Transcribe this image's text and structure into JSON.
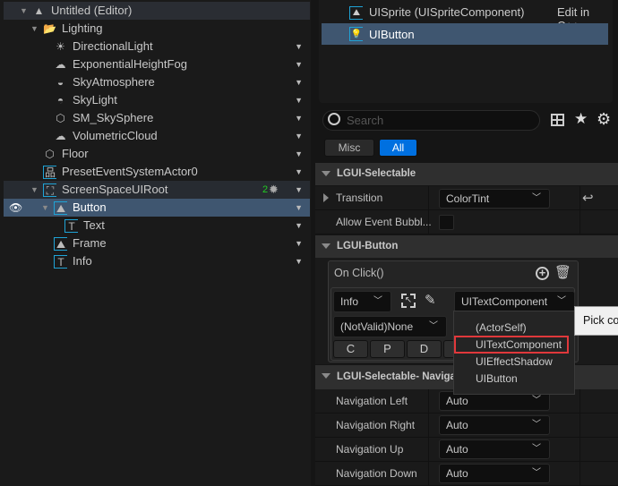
{
  "outliner": {
    "items": [
      {
        "label": "Untitled (Editor)",
        "icon": "level-icon",
        "depth": 0,
        "expanded": true
      },
      {
        "label": "Lighting",
        "icon": "folder-icon",
        "depth": 1,
        "expanded": true
      },
      {
        "label": "DirectionalLight",
        "icon": "directional-light-icon",
        "depth": 2
      },
      {
        "label": "ExponentialHeightFog",
        "icon": "fog-icon",
        "depth": 2
      },
      {
        "label": "SkyAtmosphere",
        "icon": "sky-atmosphere-icon",
        "depth": 2
      },
      {
        "label": "SkyLight",
        "icon": "sky-light-icon",
        "depth": 2
      },
      {
        "label": "SM_SkySphere",
        "icon": "static-mesh-icon",
        "depth": 2
      },
      {
        "label": "VolumetricCloud",
        "icon": "cloud-icon",
        "depth": 2
      },
      {
        "label": "Floor",
        "icon": "static-mesh-icon",
        "depth": 1
      },
      {
        "label": "PresetEventSystemActor0",
        "icon": "event-system-icon",
        "depth": 1
      },
      {
        "label": "ScreenSpaceUIRoot",
        "icon": "ui-root-icon",
        "depth": 1,
        "expanded": true,
        "badge": "2"
      },
      {
        "label": "Button",
        "icon": "ui-sprite-icon",
        "depth": 2,
        "expanded": true,
        "selected": true
      },
      {
        "label": "Text",
        "icon": "ui-text-icon",
        "depth": 3
      },
      {
        "label": "Frame",
        "icon": "ui-sprite-icon",
        "depth": 2
      },
      {
        "label": "Info",
        "icon": "ui-text-icon",
        "depth": 2
      }
    ]
  },
  "components": {
    "items": [
      {
        "label": "UISprite (UISpriteComponent)",
        "link": "Edit in C++"
      },
      {
        "label": "UIButton",
        "selected": true
      }
    ]
  },
  "details": {
    "search_placeholder": "Search",
    "filters": [
      "Misc",
      "All"
    ],
    "active_filter": "All",
    "sections": {
      "selectable": "LGUI-Selectable",
      "button": "LGUI-Button",
      "navigation": "LGUI-Selectable- Navigation"
    },
    "transition": {
      "label": "Transition",
      "value": "ColorTint"
    },
    "allow_bubble": {
      "label": "Allow Event Bubbl...",
      "checked": false
    },
    "on_click": {
      "title": "On Click()",
      "actor": "Info",
      "component": "UITextComponent",
      "function": "(NotValid)None",
      "param_buttons": [
        "C",
        "P",
        "D"
      ]
    },
    "component_menu": {
      "items": [
        "(ActorSelf)",
        "UITextComponent",
        "UIEffectShadow",
        "UIButton"
      ],
      "highlighted": "UITextComponent"
    },
    "tooltip": "Pick co",
    "navigation": [
      {
        "label": "Navigation Left",
        "value": "Auto"
      },
      {
        "label": "Navigation Right",
        "value": "Auto"
      },
      {
        "label": "Navigation Up",
        "value": "Auto"
      },
      {
        "label": "Navigation Down",
        "value": "Auto"
      }
    ]
  },
  "colors": {
    "selection": "#3f5670",
    "accent": "#0070e0",
    "highlight_border": "#e0383b",
    "badge": "#22cc22"
  }
}
